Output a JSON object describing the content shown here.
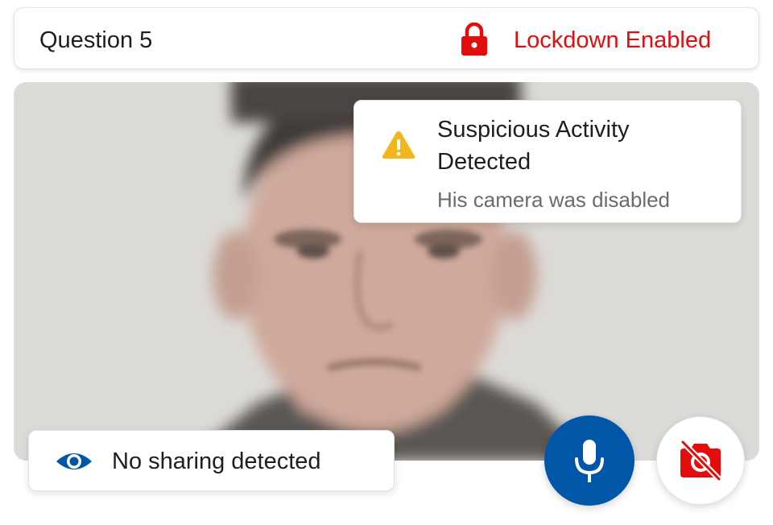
{
  "header": {
    "question_label": "Question 5",
    "lock_icon": "lock-icon",
    "lockdown_label": "Lockdown Enabled"
  },
  "alert": {
    "icon": "warning-icon",
    "title": "Suspicious Activity Detected",
    "body": "His camera was disabled"
  },
  "sharing_status": {
    "icon": "eye-icon",
    "label": "No sharing detected"
  },
  "controls": {
    "mic_icon": "microphone-icon",
    "camera_icon": "camera-off-icon"
  },
  "colors": {
    "accent_blue": "#0057a8",
    "alert_red": "#e30d0d",
    "warning_yellow": "#f2b51c"
  }
}
